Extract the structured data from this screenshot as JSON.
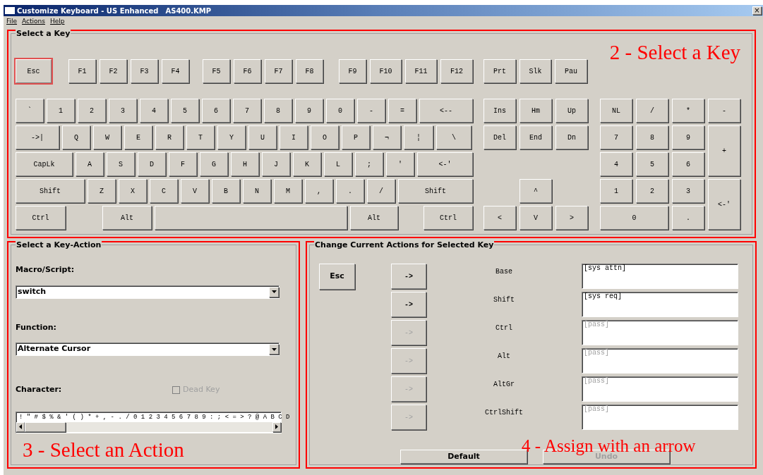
{
  "window": {
    "title": "Customize Keyboard - US Enhanced",
    "file": "AS400.KMP",
    "close": "×"
  },
  "menu": [
    "File",
    "Actions",
    "Help"
  ],
  "key_group": {
    "title": "Select a Key",
    "annotation": "2 - Select a Key",
    "function_row": [
      {
        "label": "Esc",
        "selected": true
      },
      {
        "label": "F1",
        "selected": false
      },
      {
        "label": "F2",
        "selected": false
      },
      {
        "label": "F3",
        "selected": false
      },
      {
        "label": "F4",
        "selected": false
      },
      {
        "label": "F5",
        "selected": false
      },
      {
        "label": "F6",
        "selected": false
      },
      {
        "label": "F7",
        "selected": false
      },
      {
        "label": "F8",
        "selected": false
      },
      {
        "label": "F9",
        "selected": false
      },
      {
        "label": "F10",
        "selected": false
      },
      {
        "label": "F11",
        "selected": false
      },
      {
        "label": "F12",
        "selected": false
      },
      {
        "label": "Prt",
        "selected": false
      },
      {
        "label": "Slk",
        "selected": false
      },
      {
        "label": "Pau",
        "selected": false
      }
    ],
    "main_rows": [
      [
        {
          "label": "`",
          "selected": false
        },
        {
          "label": "1",
          "selected": false
        },
        {
          "label": "2",
          "selected": false
        },
        {
          "label": "3",
          "selected": false
        },
        {
          "label": "4",
          "selected": false
        },
        {
          "label": "5",
          "selected": false
        },
        {
          "label": "6",
          "selected": false
        },
        {
          "label": "7",
          "selected": false
        },
        {
          "label": "8",
          "selected": false
        },
        {
          "label": "9",
          "selected": false
        },
        {
          "label": "0",
          "selected": false
        },
        {
          "label": "-",
          "selected": false
        },
        {
          "label": "=",
          "selected": false
        },
        {
          "label": "<--",
          "selected": false
        }
      ],
      [
        {
          "label": "->|",
          "selected": false
        },
        {
          "label": "Q",
          "selected": false
        },
        {
          "label": "W",
          "selected": false
        },
        {
          "label": "E",
          "selected": false
        },
        {
          "label": "R",
          "selected": false
        },
        {
          "label": "T",
          "selected": false
        },
        {
          "label": "Y",
          "selected": false
        },
        {
          "label": "U",
          "selected": false
        },
        {
          "label": "I",
          "selected": false
        },
        {
          "label": "O",
          "selected": false
        },
        {
          "label": "P",
          "selected": false
        },
        {
          "label": "¬",
          "selected": false
        },
        {
          "label": "¦",
          "selected": false
        },
        {
          "label": "\\",
          "selected": false
        }
      ],
      [
        {
          "label": "CapLk",
          "selected": false
        },
        {
          "label": "A",
          "selected": false
        },
        {
          "label": "S",
          "selected": false
        },
        {
          "label": "D",
          "selected": false
        },
        {
          "label": "F",
          "selected": false
        },
        {
          "label": "G",
          "selected": false
        },
        {
          "label": "H",
          "selected": false
        },
        {
          "label": "J",
          "selected": false
        },
        {
          "label": "K",
          "selected": false
        },
        {
          "label": "L",
          "selected": false
        },
        {
          "label": ";",
          "selected": false
        },
        {
          "label": "'",
          "selected": false
        },
        {
          "label": "<-'",
          "selected": false
        }
      ],
      [
        {
          "label": "Shift",
          "selected": false
        },
        {
          "label": "Z",
          "selected": false
        },
        {
          "label": "X",
          "selected": false
        },
        {
          "label": "C",
          "selected": false
        },
        {
          "label": "V",
          "selected": false
        },
        {
          "label": "B",
          "selected": false
        },
        {
          "label": "N",
          "selected": false
        },
        {
          "label": "M",
          "selected": false
        },
        {
          "label": ",",
          "selected": false
        },
        {
          "label": ".",
          "selected": false
        },
        {
          "label": "/",
          "selected": false
        },
        {
          "label": "Shift",
          "selected": false
        }
      ],
      [
        {
          "label": "Ctrl",
          "selected": false
        },
        {
          "label": "Alt",
          "selected": false
        },
        {
          "selected": false
        },
        {
          "label": "Alt",
          "selected": false
        },
        {
          "label": "Ctrl",
          "selected": false
        }
      ]
    ],
    "nav_keys": [
      {
        "label": "Ins",
        "selected": false
      },
      {
        "label": "Hm",
        "selected": false
      },
      {
        "label": "Up",
        "selected": false
      },
      {
        "label": "Del",
        "selected": false
      },
      {
        "label": "End",
        "selected": false
      },
      {
        "label": "Dn",
        "selected": false
      },
      {
        "label": "^",
        "selected": false
      },
      {
        "label": "<",
        "selected": false
      },
      {
        "label": "V",
        "selected": false
      },
      {
        "label": ">",
        "selected": false
      }
    ],
    "numpad_keys": [
      {
        "label": "NL",
        "selected": false
      },
      {
        "label": "/",
        "selected": false
      },
      {
        "label": "*",
        "selected": false
      },
      {
        "label": "-",
        "selected": false
      },
      {
        "label": "7",
        "selected": false
      },
      {
        "label": "8",
        "selected": false
      },
      {
        "label": "9",
        "selected": false
      },
      {
        "label": "+",
        "selected": false
      },
      {
        "label": "4",
        "selected": false
      },
      {
        "label": "5",
        "selected": false
      },
      {
        "label": "6",
        "selected": false
      },
      {
        "label": "1",
        "selected": false
      },
      {
        "label": "2",
        "selected": false
      },
      {
        "label": "3",
        "selected": false
      },
      {
        "label": "<-'",
        "selected": false
      },
      {
        "label": "0",
        "selected": false
      },
      {
        "label": ".",
        "selected": false
      }
    ]
  },
  "action_group": {
    "title": "Select a Key-Action",
    "annotation": "3 - Select an Action",
    "macro": {
      "label": "Macro/Script:",
      "value": "switch"
    },
    "function": {
      "label": "Function:",
      "value": "Alternate Cursor"
    },
    "character": {
      "label": "Character:",
      "characters": "! \" # $ % & ' ( ) * + , - . / 0 1 2 3 4 5 6 7 8 9 : ; < = > ? @ A B C D"
    },
    "dead_key": {
      "label": "Dead Key",
      "checked": false,
      "disabled": true
    }
  },
  "current_group": {
    "title": "Change Current Actions for Selected Key",
    "annotation": "4 - Assign with an arrow",
    "key": "Esc",
    "actions": [
      {
        "arrow": "->",
        "arrow_disabled": false,
        "label": "Base",
        "value": "[sys attn]"
      },
      {
        "arrow": "->",
        "arrow_disabled": false,
        "label": "Shift",
        "value": "[sys req]"
      },
      {
        "arrow": "->",
        "arrow_disabled": true,
        "label": "Ctrl",
        "placeholder": "[pass]"
      },
      {
        "arrow": "->",
        "arrow_disabled": true,
        "label": "Alt",
        "placeholder": "[pass]"
      },
      {
        "arrow": "->",
        "arrow_disabled": true,
        "label": "AltGr",
        "placeholder": "[pass]"
      },
      {
        "arrow": "->",
        "arrow_disabled": true,
        "label": "CtrlShift",
        "placeholder": "[pass]"
      }
    ],
    "buttons": [
      {
        "label": "Default",
        "disabled": false
      },
      {
        "label": "Undo",
        "disabled": true
      }
    ]
  }
}
